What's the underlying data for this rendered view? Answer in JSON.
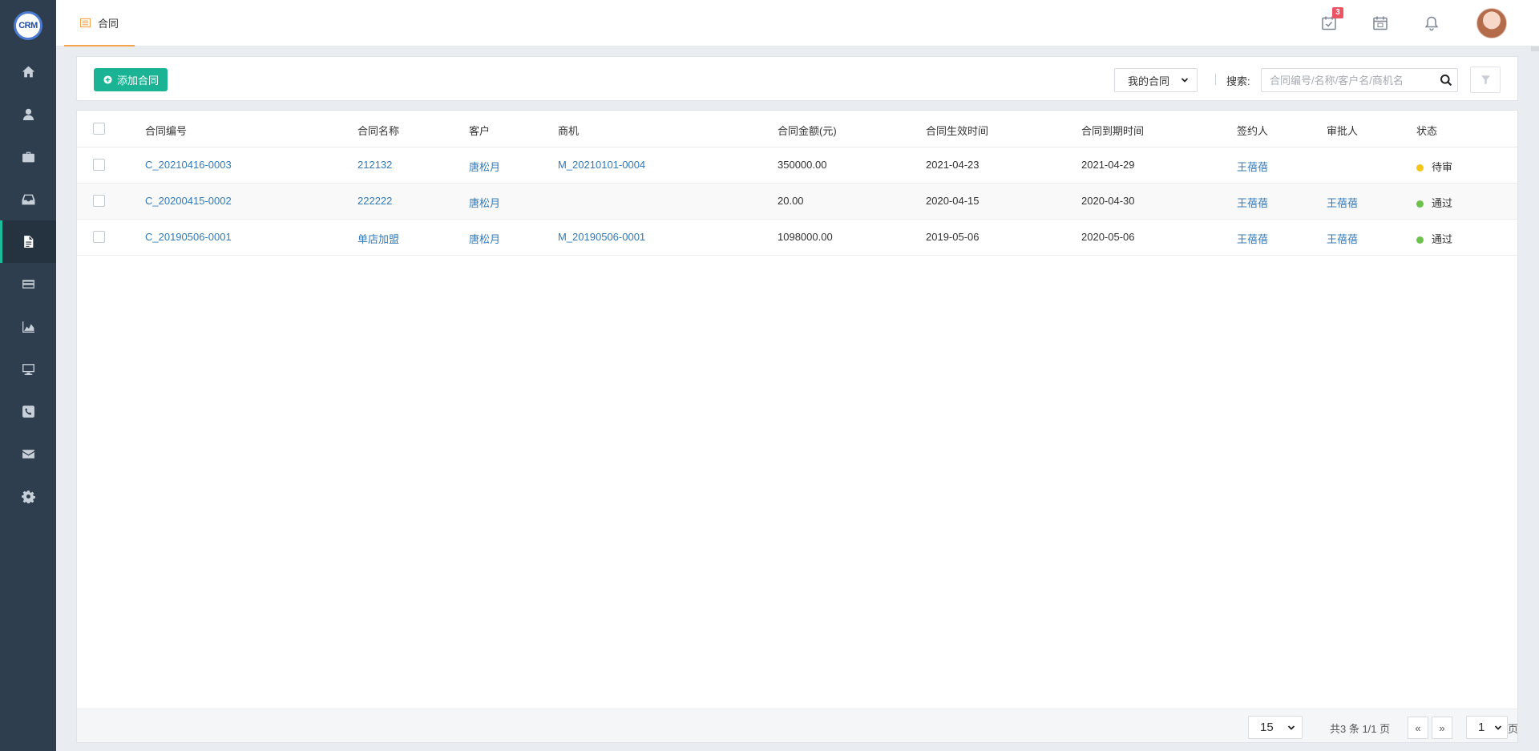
{
  "app": {
    "logo_text": "CRM",
    "page_tab_label": "合同",
    "reminder_badge": "3",
    "colors": {
      "sidebar": "#2f3e4e",
      "accent": "#1ab394",
      "link": "#337ab7",
      "tab_underline": "#f5a34b",
      "badge": "#ed5565"
    }
  },
  "sidebar": {
    "items": [
      {
        "icon": "home-icon",
        "active": false
      },
      {
        "icon": "user-icon",
        "active": false
      },
      {
        "icon": "briefcase-icon",
        "active": false
      },
      {
        "icon": "inbox-icon",
        "active": false
      },
      {
        "icon": "document-icon",
        "active": true
      },
      {
        "icon": "credit-card-icon",
        "active": false
      },
      {
        "icon": "area-chart-icon",
        "active": false
      },
      {
        "icon": "monitor-icon",
        "active": false
      },
      {
        "icon": "phone-icon",
        "active": false
      },
      {
        "icon": "mail-icon",
        "active": false
      },
      {
        "icon": "gear-icon",
        "active": false
      }
    ]
  },
  "toolbar": {
    "add_label": "添加合同",
    "scope_value": "我的合同",
    "search_label": "搜索:",
    "search_placeholder": "合同编号/名称/客户名/商机名"
  },
  "table": {
    "headers": {
      "code": "合同编号",
      "name": "合同名称",
      "customer": "客户",
      "opportunity": "商机",
      "amount": "合同金额(元)",
      "start": "合同生效时间",
      "end": "合同到期时间",
      "signer": "签约人",
      "approver": "审批人",
      "status": "状态"
    },
    "rows": [
      {
        "code": "C_20210416-0003",
        "name": "212132",
        "customer": "唐松月",
        "opportunity": "M_20210101-0004",
        "amount": "350000.00",
        "start": "2021-04-23",
        "end": "2021-04-29",
        "signer": "王蓓蓓",
        "approver": "",
        "status": "待审",
        "status_color": "#f5c518"
      },
      {
        "code": "C_20200415-0002",
        "name": "222222",
        "customer": "唐松月",
        "opportunity": "",
        "amount": "20.00",
        "start": "2020-04-15",
        "end": "2020-04-30",
        "signer": "王蓓蓓",
        "approver": "王蓓蓓",
        "status": "通过",
        "status_color": "#6cc24a"
      },
      {
        "code": "C_20190506-0001",
        "name": "单店加盟",
        "customer": "唐松月",
        "opportunity": "M_20190506-0001",
        "amount": "1098000.00",
        "start": "2019-05-06",
        "end": "2020-05-06",
        "signer": "王蓓蓓",
        "approver": "王蓓蓓",
        "status": "通过",
        "status_color": "#6cc24a"
      }
    ]
  },
  "pager": {
    "page_size": "15",
    "info": "共3 条 1/1 页",
    "prev": "«",
    "next": "»",
    "current_page": "1",
    "unit": "页"
  }
}
